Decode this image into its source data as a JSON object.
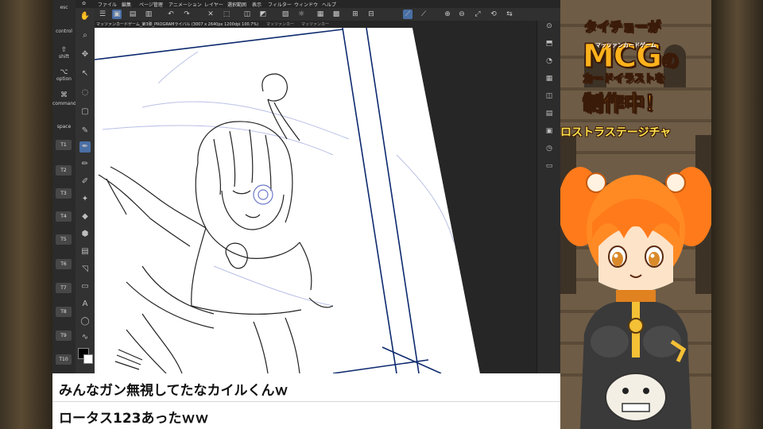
{
  "menubar": {
    "items": [
      "ファイル",
      "編集",
      "ページ管理",
      "アニメーション",
      "レイヤー",
      "選択範囲",
      "表示",
      "フィルター",
      "ウィンドウ",
      "ヘルプ"
    ]
  },
  "document_tab": {
    "active": "マッツァンカードゲーム_第3弾_PROGRAMライバル (3007 x 2640px 1200dpi 100.7%)",
    "second": "マッツァンカー",
    "third": "マッツァンカー"
  },
  "shortcut_keys": [
    "esc",
    "control",
    "shift",
    "option",
    "command",
    "space"
  ],
  "tool_keys": [
    "T1",
    "T2",
    "T3",
    "T4",
    "T5",
    "T6",
    "T7",
    "T8",
    "T9",
    "T10"
  ],
  "chat": {
    "line1": "みんなガン無視してたなカイルくんｗ",
    "line2": "ロータス123あったｗｗ"
  },
  "stream_title": {
    "line1": "タイチョーが",
    "line2": "MCG",
    "line2_particle": "の",
    "line2_sub": "マッツァンカードゲーム",
    "line3": "カードイラストを",
    "line4": "制作中！",
    "ticker": "ロストラステージチャ"
  },
  "colors": {
    "accent_orange": "#ffb21c",
    "title_outline": "#3a1a08",
    "line_art_blue": "#0d2a6e"
  }
}
